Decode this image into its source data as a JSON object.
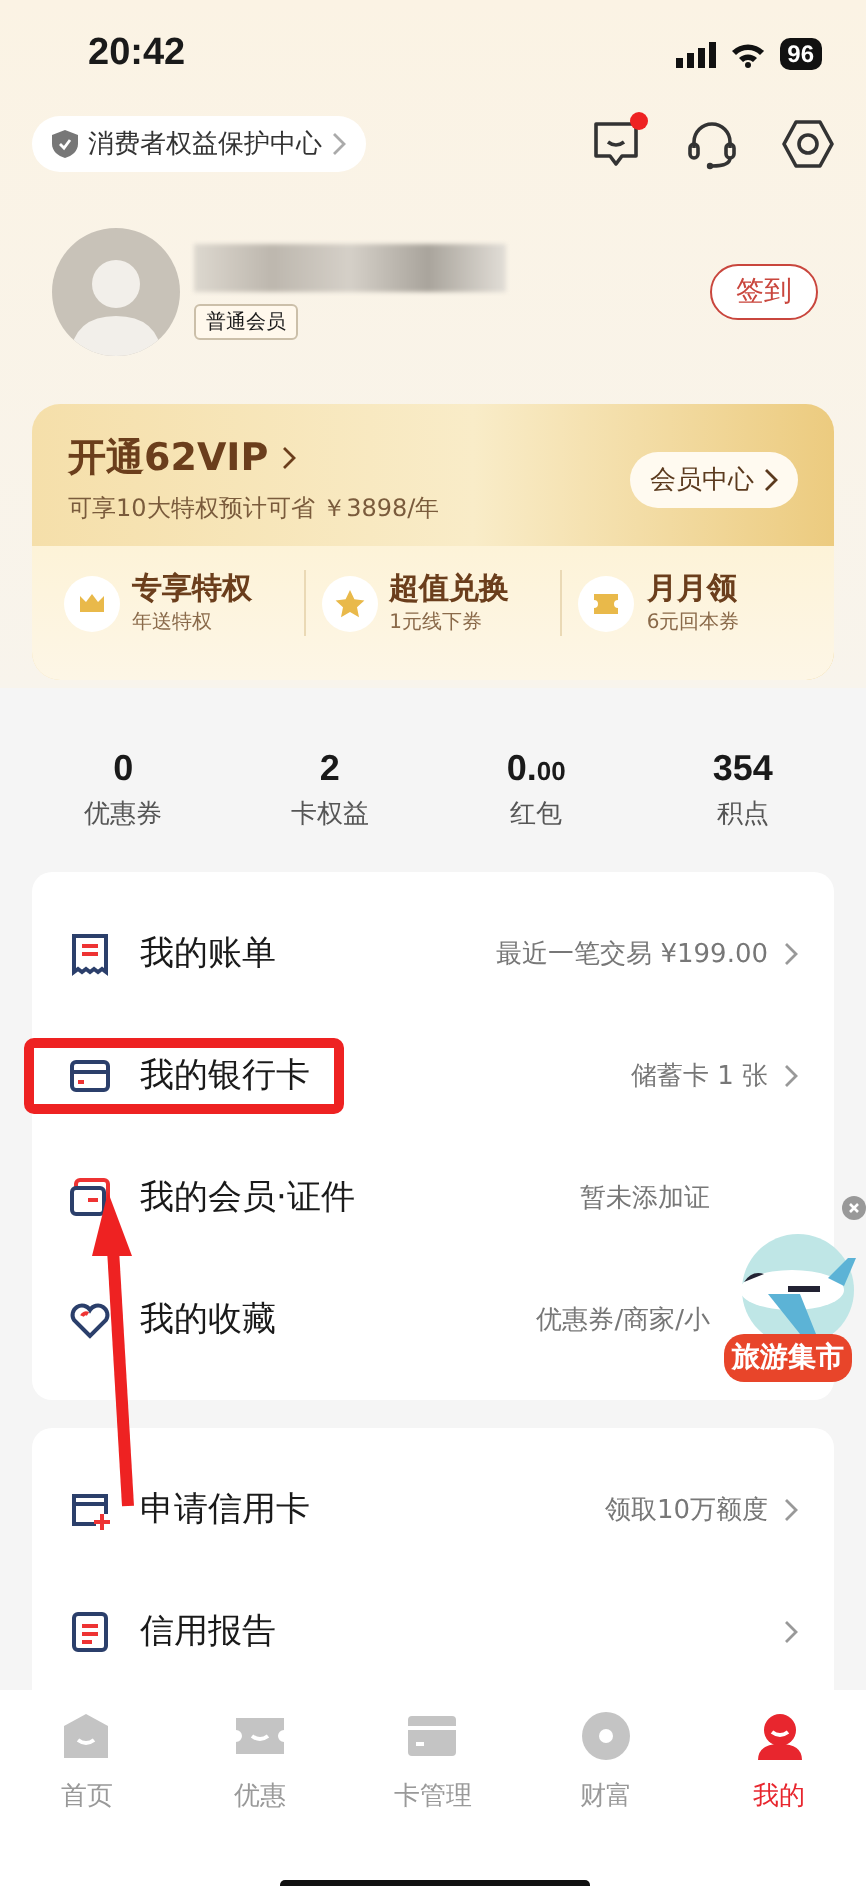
{
  "status_bar": {
    "time": "20:42",
    "battery": "96"
  },
  "header": {
    "consumer_link": "消费者权益保护中心",
    "messages_unread": true
  },
  "profile": {
    "member_badge": "普通会员",
    "checkin_button": "签到"
  },
  "vip": {
    "title": "开通62VIP",
    "subtitle": "可享10大特权预计可省 ￥3898/年",
    "button": "会员中心",
    "perks": [
      {
        "kind": "crown",
        "title": "专享特权",
        "subtitle": "年送特权"
      },
      {
        "kind": "star",
        "title": "超值兑换",
        "subtitle": "1元线下券"
      },
      {
        "kind": "ticket",
        "title": "月月领",
        "subtitle": "6元回本券"
      }
    ]
  },
  "stats": [
    {
      "value": "0",
      "label": "优惠券"
    },
    {
      "value": "2",
      "label": "卡权益"
    },
    {
      "value": "0.",
      "value_small": "00",
      "label": "红包"
    },
    {
      "value": "354",
      "label": "积点"
    }
  ],
  "sections": [
    {
      "items": [
        {
          "kind": "bill",
          "label": "我的账单",
          "value": "最近一笔交易 ¥199.00",
          "highlighted": false
        },
        {
          "kind": "card",
          "label": "我的银行卡",
          "value": "储蓄卡 1 张",
          "highlighted": true
        },
        {
          "kind": "cards",
          "label": "我的会员·证件",
          "value": "暂未添加证",
          "highlighted": false
        },
        {
          "kind": "heart",
          "label": "我的收藏",
          "value": "优惠券/商家/小",
          "highlighted": false
        }
      ]
    },
    {
      "items": [
        {
          "kind": "card-add",
          "label": "申请信用卡",
          "value": "领取10万额度",
          "highlighted": false
        },
        {
          "kind": "report",
          "label": "信用报告",
          "highlighted": false
        }
      ]
    }
  ],
  "floating_ad": {
    "label": "旅游集市"
  },
  "tab_bar": [
    {
      "kind": "home",
      "label": "首页",
      "selected": false
    },
    {
      "kind": "deal",
      "label": "优惠",
      "selected": false
    },
    {
      "kind": "card",
      "label": "卡管理",
      "selected": false
    },
    {
      "kind": "coin",
      "label": "财富",
      "selected": false
    },
    {
      "kind": "me",
      "label": "我的",
      "selected": true
    }
  ]
}
